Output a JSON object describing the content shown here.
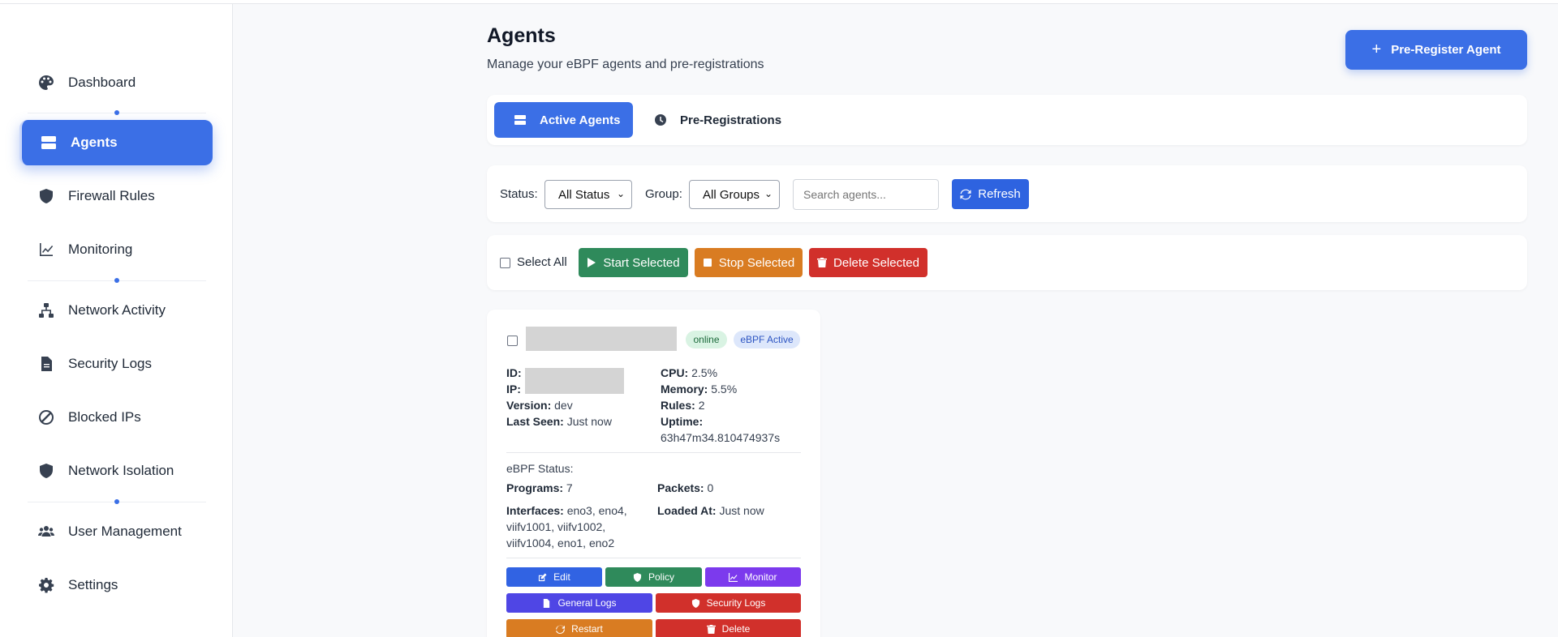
{
  "sidebar": {
    "items": [
      {
        "label": "Dashboard",
        "icon": "palette-icon"
      },
      {
        "label": "Agents",
        "icon": "server-icon",
        "active": true
      },
      {
        "label": "Firewall Rules",
        "icon": "shield-icon"
      },
      {
        "label": "Monitoring",
        "icon": "chart-line-icon"
      },
      {
        "label": "Network Activity",
        "icon": "network-icon"
      },
      {
        "label": "Security Logs",
        "icon": "file-icon"
      },
      {
        "label": "Blocked IPs",
        "icon": "ban-icon"
      },
      {
        "label": "Network Isolation",
        "icon": "shield-icon"
      },
      {
        "label": "User Management",
        "icon": "users-icon"
      },
      {
        "label": "Settings",
        "icon": "gear-icon"
      }
    ]
  },
  "header": {
    "title": "Agents",
    "subtitle": "Manage your eBPF agents and pre-registrations",
    "prereg_button": "Pre-Register Agent"
  },
  "tabs": [
    {
      "label": "Active Agents",
      "active": true
    },
    {
      "label": "Pre-Registrations",
      "active": false
    }
  ],
  "filters": {
    "status_label": "Status:",
    "status_value": "All Status",
    "group_label": "Group:",
    "group_value": "All Groups",
    "search_placeholder": "Search agents...",
    "refresh_label": "Refresh"
  },
  "bulk": {
    "select_all": "Select All",
    "start": "Start Selected",
    "stop": "Stop Selected",
    "delete": "Delete Selected"
  },
  "agent": {
    "status": "online",
    "ebpf_badge": "eBPF Active",
    "id_label": "ID:",
    "ip_label": "IP:",
    "version_label": "Version:",
    "version": "dev",
    "last_seen_label": "Last Seen:",
    "last_seen": "Just now",
    "cpu_label": "CPU:",
    "cpu": "2.5%",
    "memory_label": "Memory:",
    "memory": "5.5%",
    "rules_label": "Rules:",
    "rules": "2",
    "uptime_label": "Uptime:",
    "uptime": "63h47m34.810474937s",
    "ebpf_status_label": "eBPF Status:",
    "programs_label": "Programs:",
    "programs": "7",
    "packets_label": "Packets:",
    "packets": "0",
    "interfaces_label": "Interfaces:",
    "interfaces_l1": "eno3, eno4,",
    "interfaces_l2": "viifv1001, viifv1002,",
    "interfaces_l3": "viifv1004, eno1, eno2",
    "loaded_at_label": "Loaded At:",
    "loaded_at": "Just now",
    "actions": {
      "edit": "Edit",
      "policy": "Policy",
      "monitor": "Monitor",
      "general_logs": "General Logs",
      "security_logs": "Security Logs",
      "restart": "Restart",
      "delete": "Delete"
    }
  },
  "colors": {
    "primary": "#3b6fe6",
    "success": "#2f8a5b",
    "warning": "#d97c22",
    "danger": "#d1302b",
    "purple": "#7c3aed",
    "indigo": "#4f46e5"
  }
}
